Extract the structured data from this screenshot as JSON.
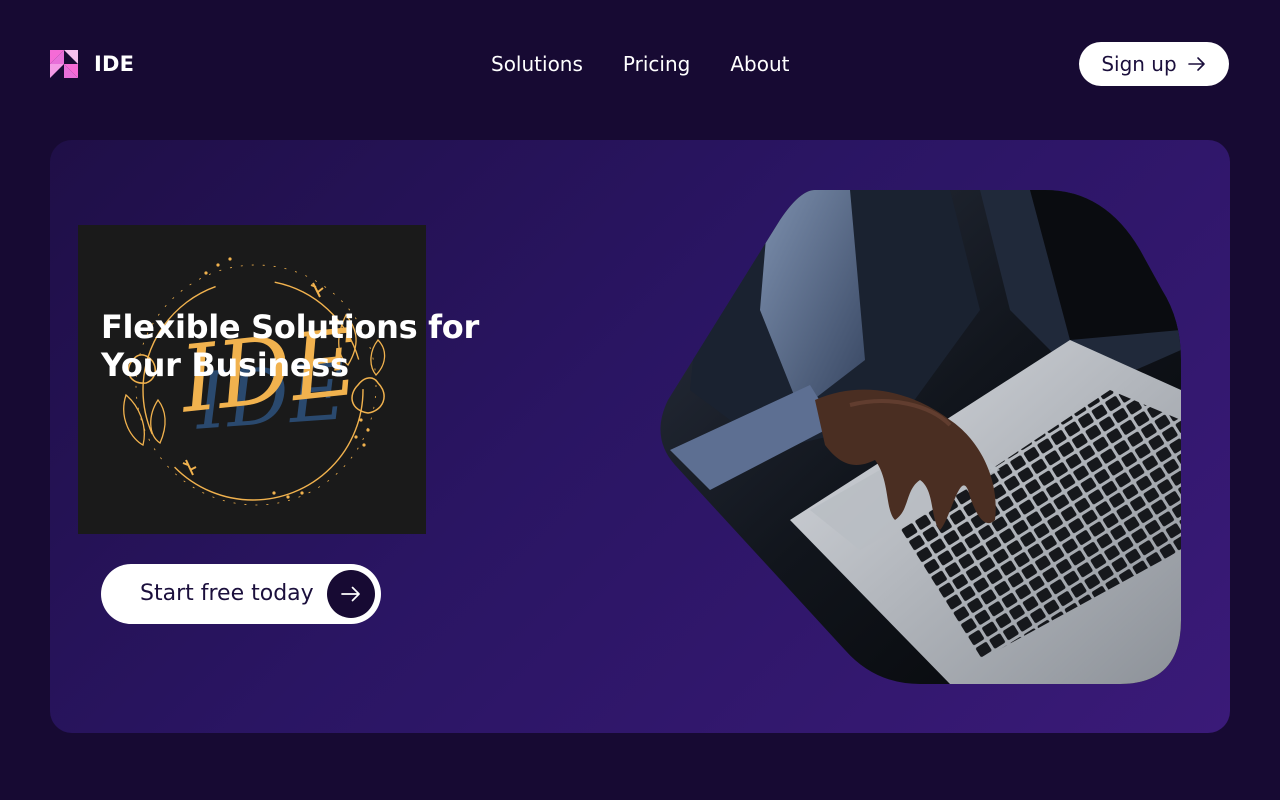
{
  "brand": {
    "name": "IDE",
    "logo_icon": "triangles-logo-icon"
  },
  "nav": {
    "items": [
      {
        "label": "Solutions"
      },
      {
        "label": "Pricing"
      },
      {
        "label": "About"
      }
    ]
  },
  "header": {
    "signup_label": "Sign up",
    "signup_icon": "arrow-right-icon"
  },
  "hero": {
    "title": "Flexible Solutions for Your Business",
    "cta_label": "Start free today",
    "cta_icon": "arrow-right-icon",
    "brand_image_monogram": "IDE",
    "photo": "person-typing-on-laptop"
  },
  "colors": {
    "page_background": "#170a33",
    "hero_gradient_start": "#1f0f47",
    "hero_gradient_end": "#3a1a78",
    "button_background": "#ffffff",
    "button_text": "#1b0f3c",
    "logo_pink": "#f56bd6",
    "gold_accent": "#f1b24e"
  }
}
